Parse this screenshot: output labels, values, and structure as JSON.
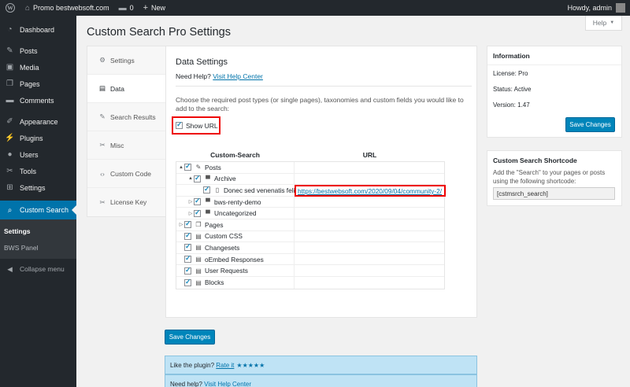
{
  "adminbar": {
    "site_name": "Promo bestwebsoft.com",
    "comments_count": "0",
    "new_label": "New",
    "howdy": "Howdy, admin"
  },
  "sidebar": {
    "items": [
      {
        "label": "Dashboard",
        "icon": "dashboard-icon"
      },
      {
        "label": "Posts",
        "icon": "pin-icon"
      },
      {
        "label": "Media",
        "icon": "media-icon"
      },
      {
        "label": "Pages",
        "icon": "pages-icon"
      },
      {
        "label": "Comments",
        "icon": "comments-icon"
      },
      {
        "label": "Appearance",
        "icon": "appearance-icon"
      },
      {
        "label": "Plugins",
        "icon": "plugins-icon"
      },
      {
        "label": "Users",
        "icon": "users-icon"
      },
      {
        "label": "Tools",
        "icon": "tools-icon"
      },
      {
        "label": "Settings",
        "icon": "settings-icon"
      },
      {
        "label": "Custom Search",
        "icon": "search-icon"
      }
    ],
    "submenu": [
      "Settings",
      "BWS Panel"
    ],
    "collapse_label": "Collapse menu"
  },
  "header": {
    "title": "Custom Search Pro Settings",
    "help_label": "Help"
  },
  "tabs": [
    {
      "label": "Settings"
    },
    {
      "label": "Data"
    },
    {
      "label": "Search Results"
    },
    {
      "label": "Misc"
    },
    {
      "label": "Custom Code"
    },
    {
      "label": "License Key"
    }
  ],
  "main": {
    "section_title": "Data Settings",
    "need_help": "Need Help?",
    "help_center_link": "Visit Help Center",
    "description": "Choose the required post types (or single pages), taxonomies and custom fields you would like to add to the search:",
    "show_url_label": "Show URL",
    "table": {
      "col1": "Custom-Search",
      "col2": "URL",
      "rows": [
        {
          "label": "Posts",
          "level": 0,
          "arrow": "▲",
          "icon": "pin-icon"
        },
        {
          "label": "Archive",
          "level": 1,
          "arrow": "▲",
          "icon": "folder-icon"
        },
        {
          "label": "Donec sed venenatis felis",
          "level": 2,
          "arrow": "",
          "icon": "document-icon",
          "url": "https://bestwebsoft.com/2020/09/04/community-2/"
        },
        {
          "label": "bws-renty-demo",
          "level": 1,
          "arrow": "▷",
          "icon": "folder-icon"
        },
        {
          "label": "Uncategorized",
          "level": 1,
          "arrow": "▷",
          "icon": "folder-icon"
        },
        {
          "label": "Pages",
          "level": 0,
          "arrow": "▷",
          "icon": "pages-icon"
        },
        {
          "label": "Custom CSS",
          "level": 0,
          "arrow": "",
          "icon": "list-icon"
        },
        {
          "label": "Changesets",
          "level": 0,
          "arrow": "",
          "icon": "list-icon"
        },
        {
          "label": "oEmbed Responses",
          "level": 0,
          "arrow": "",
          "icon": "list-icon"
        },
        {
          "label": "User Requests",
          "level": 0,
          "arrow": "",
          "icon": "list-icon"
        },
        {
          "label": "Blocks",
          "level": 0,
          "arrow": "",
          "icon": "list-icon"
        }
      ]
    },
    "save_label": "Save Changes",
    "like_text": "Like the plugin?",
    "rate_link": "Rate it",
    "stars": "★★★★★",
    "need_help2": "Need help?",
    "help_center_link2": "Visit Help Center"
  },
  "info_box": {
    "title": "Information",
    "license": "License: Pro",
    "status": "Status: Active",
    "version": "Version: 1.47",
    "save_label": "Save Changes"
  },
  "shortcode_box": {
    "title": "Custom Search Shortcode",
    "desc": "Add the \"Search\" to your pages or posts using the following shortcode:",
    "shortcode": "[cstmsrch_search]"
  },
  "colors": {
    "accent": "#0073aa",
    "button": "#0085ba",
    "highlight_border": "#ee0000",
    "admin_dark": "#23282d"
  }
}
